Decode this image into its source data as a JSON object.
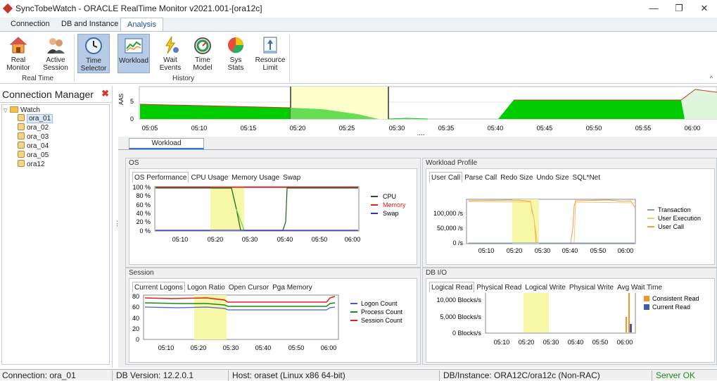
{
  "window": {
    "title": "SyncTobeWatch - ORACLE RealTime Monitor v2021.001-[ora12c]",
    "minimize": "—",
    "maximize": "❐",
    "close": "✕"
  },
  "ribbon": {
    "tabs": [
      "Connection",
      "DB and Instance",
      "Analysis"
    ],
    "active_tab": "Analysis",
    "groups": {
      "realtime": {
        "label": "Real Time",
        "buttons": [
          {
            "line1": "Real",
            "line2": "Monitor",
            "icon": "house-icon"
          },
          {
            "line1": "Active",
            "line2": "Session",
            "icon": "users-icon"
          }
        ]
      },
      "history": {
        "label": "History",
        "buttons": [
          {
            "line1": "Time",
            "line2": "Selector",
            "icon": "clock-icon"
          },
          {
            "line1": "Workload",
            "line2": "",
            "icon": "workload-chart-icon"
          },
          {
            "line1": "Wait",
            "line2": "Events",
            "icon": "wait-events-icon"
          },
          {
            "line1": "Time",
            "line2": "Model",
            "icon": "time-model-icon"
          },
          {
            "line1": "Sys",
            "line2": "Stats",
            "icon": "pie-chart-icon"
          },
          {
            "line1": "Resource",
            "line2": "Limit",
            "icon": "resource-limit-icon"
          }
        ]
      }
    },
    "collapse": "^"
  },
  "connection_manager": {
    "title": "Connection Manager",
    "close": "✖",
    "tree": {
      "root": "Watch",
      "items": [
        "ora_01",
        "ora_02",
        "ora_03",
        "ora_04",
        "ora_05",
        "ora12"
      ],
      "selected": "ora_01"
    }
  },
  "timeline": {
    "ylabel": "AAS",
    "y_ticks": [
      "5",
      "0"
    ],
    "x_ticks": [
      "05:05",
      "05:10",
      "05:15",
      "05:20",
      "05:25",
      "05:30",
      "05:35",
      "05:40",
      "05:45",
      "05:50",
      "05:55",
      "06:00"
    ],
    "dots": "....",
    "colors": {
      "aas": "#00cc00",
      "line": "#c0392b",
      "selection": "#ffffcc"
    }
  },
  "workload_tab": "Workload",
  "panels": {
    "os": {
      "title": "OS",
      "tabs": [
        "OS Performance",
        "CPU Usage",
        "Memory Usage",
        "Swap"
      ],
      "active_tab": "OS Performance",
      "y_ticks": [
        "100 %",
        "80 %",
        "60 %",
        "40 %",
        "20 %",
        "0 %"
      ],
      "x_ticks": [
        "05:10",
        "05:20",
        "05:30",
        "05:40",
        "05:50",
        "06:00"
      ],
      "legend": [
        {
          "name": "CPU",
          "color": "#1a5c1a"
        },
        {
          "name": "Memory",
          "color": "#e02020"
        },
        {
          "name": "Swap",
          "color": "#3030c0"
        }
      ]
    },
    "workload_profile": {
      "title": "Workload Profile",
      "tabs": [
        "User Call",
        "Parse Call",
        "Redo Size",
        "Undo Size",
        "SQL*Net"
      ],
      "active_tab": "User Call",
      "y_ticks": [
        "100,000 /s",
        "50,000 /s",
        "0 /s"
      ],
      "x_ticks": [
        "05:10",
        "05:20",
        "05:30",
        "05:40",
        "05:50",
        "06:00"
      ],
      "legend": [
        {
          "name": "Transaction",
          "color": "#7b9fd4"
        },
        {
          "name": "User Execution",
          "color": "#f5c97a"
        },
        {
          "name": "User Call",
          "color": "#f0a040"
        }
      ]
    },
    "session": {
      "title": "Session",
      "tabs": [
        "Current Logons",
        "Logon Ratio",
        "Open Cursor",
        "Pga Memory"
      ],
      "active_tab": "Current Logons",
      "y_ticks": [
        "80",
        "60",
        "40",
        "20",
        "0"
      ],
      "x_ticks": [
        "05:10",
        "05:20",
        "05:30",
        "05:40",
        "05:50",
        "06:00"
      ],
      "legend": [
        {
          "name": "Logon Count",
          "color": "#4a5fd0"
        },
        {
          "name": "Process Count",
          "color": "#1a8c1a"
        },
        {
          "name": "Session Count",
          "color": "#e02020"
        }
      ]
    },
    "dbio": {
      "title": "DB I/O",
      "tabs": [
        "Logical Read",
        "Physical Read",
        "Logical Write",
        "Physical Write",
        "Avg Wait Time"
      ],
      "active_tab": "Logical Read",
      "y_ticks": [
        "10,000 Blocks/s",
        "5,000 Blocks/s",
        "0 Blocks/s"
      ],
      "x_ticks": [
        "05:10",
        "05:20",
        "05:30",
        "05:40",
        "05:50",
        "06:00"
      ],
      "legend": [
        {
          "name": "Consistent Read",
          "color": "#f0962a"
        },
        {
          "name": "Current Read",
          "color": "#3a5fa8"
        }
      ]
    }
  },
  "statusbar": {
    "connection": "Connection: ora_01",
    "db_version": "DB Version: 12.2.0.1",
    "host": "Host: oraset (Linux x86 64-bit)",
    "instance": "DB/Instance: ORA12C/ora12c (Non-RAC)",
    "server": "Server OK",
    "server_color": "#1a8c1a"
  }
}
